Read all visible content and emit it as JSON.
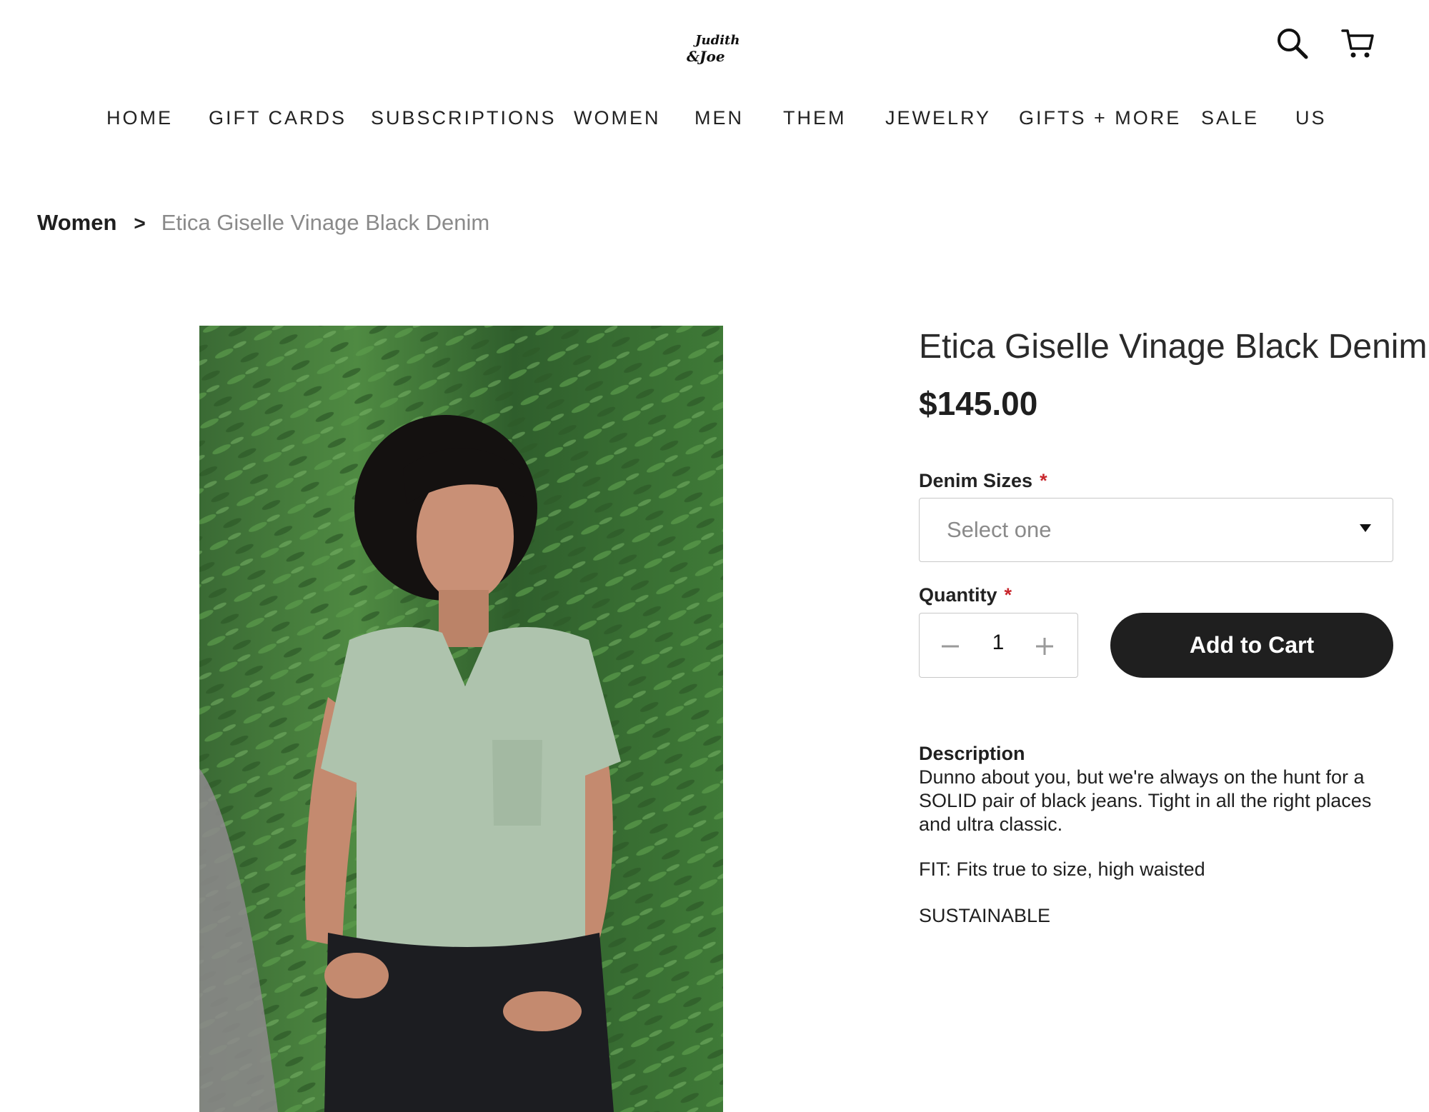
{
  "header": {
    "logo_text": "Judith & Joe",
    "search_icon": "search-icon",
    "cart_icon": "cart-icon"
  },
  "nav": {
    "items": [
      {
        "label": "HOME"
      },
      {
        "label": "GIFT CARDS"
      },
      {
        "label": "SUBSCRIPTIONS"
      },
      {
        "label": "WOMEN"
      },
      {
        "label": "MEN"
      },
      {
        "label": "THEM"
      },
      {
        "label": "JEWELRY"
      },
      {
        "label": "GIFTS + MORE"
      },
      {
        "label": "SALE"
      },
      {
        "label": "US"
      }
    ]
  },
  "breadcrumb": {
    "home": "Women",
    "separator": ">",
    "current": "Etica Giselle Vinage Black Denim"
  },
  "product": {
    "title": "Etica Giselle Vinage Black Denim",
    "price": "$145.00",
    "size_label": "Denim Sizes",
    "size_placeholder": "Select one",
    "quantity_label": "Quantity",
    "quantity_value": "1",
    "required_mark": "*",
    "add_to_cart": "Add to Cart",
    "description_heading": "Description",
    "description_text": "Dunno about you, but we're always on the hunt for a SOLID pair of black jeans. Tight in all the right places and ultra classic.",
    "fit_text": "FIT: Fits true to size, high waisted",
    "sustainable_text": "SUSTAINABLE"
  },
  "colors": {
    "button_bg": "#1f1f1f",
    "required": "#c8262c",
    "muted_text": "#8a8a8a"
  }
}
